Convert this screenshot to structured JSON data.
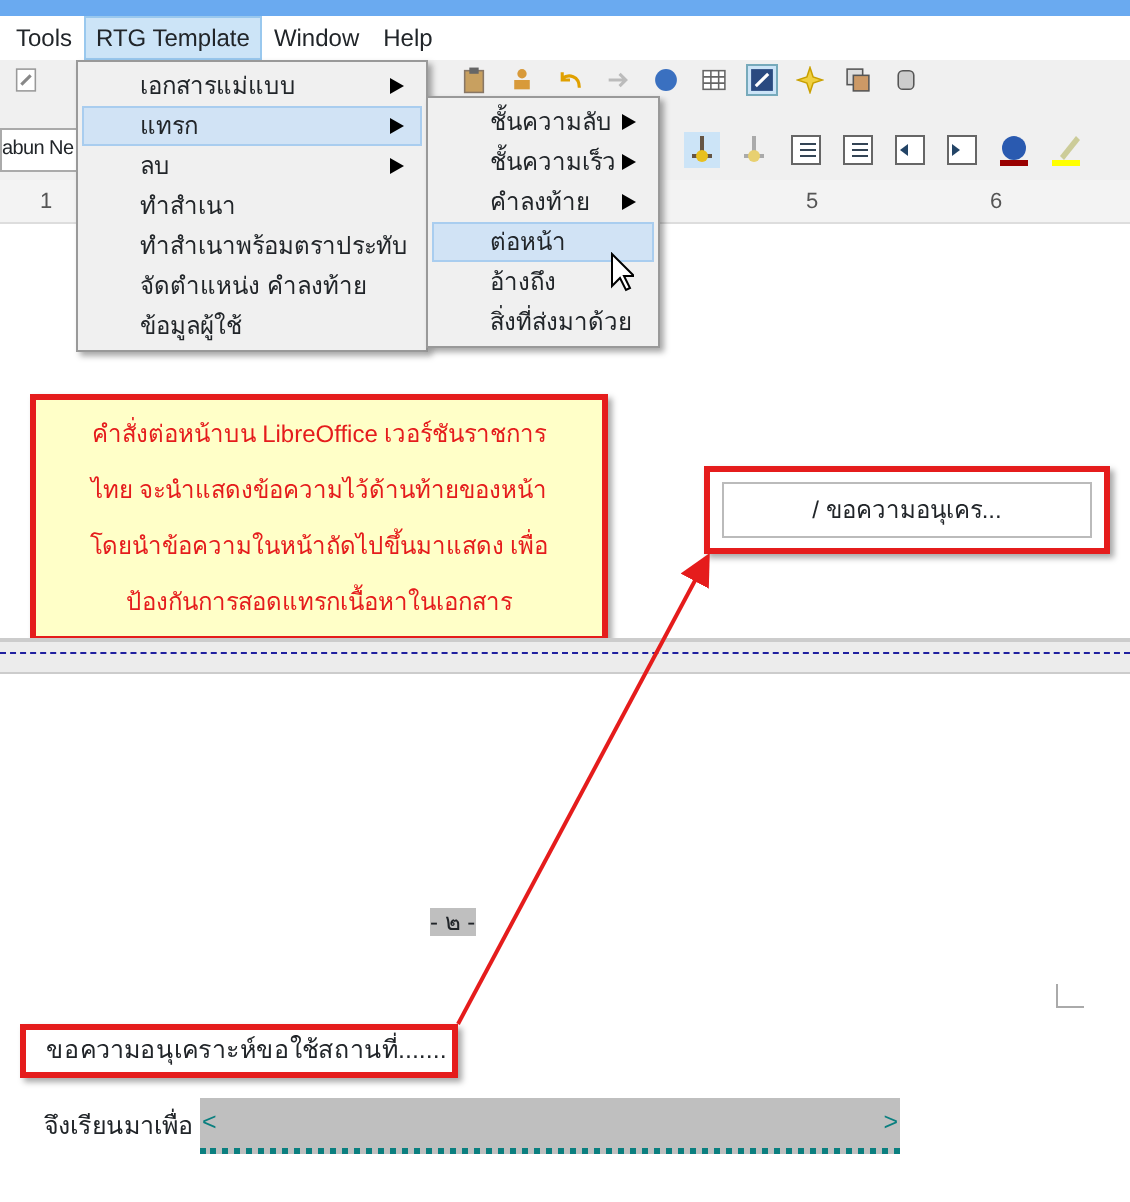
{
  "menu_bar": [
    {
      "label": "Tools",
      "selected": false
    },
    {
      "label": "RTG Template",
      "selected": true
    },
    {
      "label": "Window",
      "selected": false
    },
    {
      "label": "Help",
      "selected": false
    }
  ],
  "font_name": "abun Ne",
  "ruler_labels": [
    "1",
    "5",
    "6"
  ],
  "dropdown": [
    {
      "label": "เอกสารแม่แบบ",
      "submenu": true,
      "selected": false
    },
    {
      "label": "แทรก",
      "submenu": true,
      "selected": true
    },
    {
      "label": "ลบ",
      "submenu": true,
      "selected": false
    },
    {
      "label": "ทำสำเนา",
      "submenu": false,
      "selected": false
    },
    {
      "label": "ทำสำเนาพร้อมตราประทับ",
      "submenu": false,
      "selected": false
    },
    {
      "label": "จัดตำแหน่ง คำลงท้าย",
      "submenu": false,
      "selected": false
    },
    {
      "label": "ข้อมูลผู้ใช้",
      "submenu": false,
      "selected": false
    }
  ],
  "submenu": [
    {
      "label": "ชั้นความลับ",
      "submenu": true,
      "selected": false
    },
    {
      "label": "ชั้นความเร็ว",
      "submenu": true,
      "selected": false
    },
    {
      "label": "คำลงท้าย",
      "submenu": true,
      "selected": false
    },
    {
      "label": "ต่อหน้า",
      "submenu": false,
      "selected": true
    },
    {
      "label": "อ้างถึง",
      "submenu": false,
      "selected": false
    },
    {
      "label": "สิ่งที่ส่งมาด้วย",
      "submenu": false,
      "selected": false
    }
  ],
  "callout": {
    "lines": [
      "คำสั่งต่อหน้าบน LibreOffice เวอร์ชันราชการ",
      "ไทย จะนำแสดงข้อความไว้ด้านท้ายของหน้า",
      "โดยนำข้อความในหน้าถัดไปขึ้นมาแสดง เพื่อ",
      "ป้องกันการสอดแทรกเนื้อหาในเอกสาร"
    ]
  },
  "footer_field": "/ ขอความอนุเคร...",
  "page_number": "- ๒ -",
  "highlighted_paragraph": "ขอความอนุเคราะห์ขอใช้สถานที่.......",
  "closing": {
    "label": "จึงเรียนมาเพื่อ",
    "field_start": "<",
    "field_end": ">"
  }
}
